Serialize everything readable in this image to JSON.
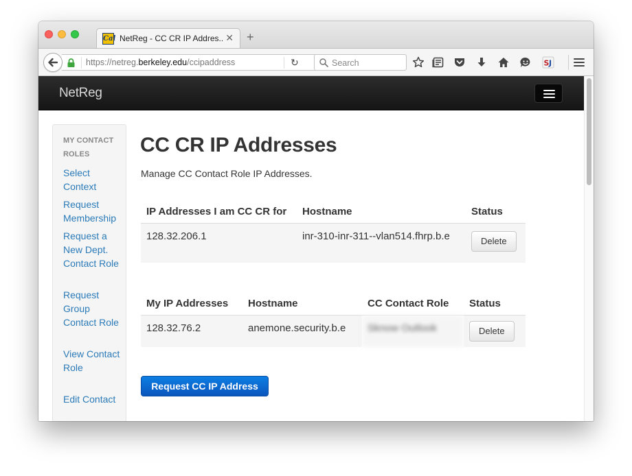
{
  "browser": {
    "tab": {
      "favicon_text": "Cal",
      "title": "NetReg - CC CR IP Addres..."
    },
    "address": {
      "prefix": "https://netreg.",
      "domain": "berkeley.edu",
      "path": "/ccipaddress"
    },
    "search_placeholder": "Search",
    "toolbar_icons": [
      "bookmark-star-icon",
      "reader-view-icon",
      "pocket-icon",
      "download-icon",
      "home-icon",
      "hello-chat-icon",
      "sj-extension-icon",
      "menu-icon"
    ]
  },
  "site": {
    "brand": "NetReg"
  },
  "sidebar": {
    "header": "MY CONTACT ROLES",
    "links": [
      "Select Context",
      "Request Membership",
      "Request a New Dept. Contact Role",
      "Request Group Contact Role",
      "View Contact Role",
      "Edit Contact"
    ]
  },
  "main": {
    "title": "CC CR IP Addresses",
    "description": "Manage CC Contact Role IP Addresses.",
    "table1": {
      "headers": [
        "IP Addresses I am CC CR for",
        "Hostname",
        "Status"
      ],
      "rows": [
        {
          "ip": "128.32.206.1",
          "hostname": "inr-310-inr-311--vlan514.fhrp.b.e",
          "action": "Delete"
        }
      ]
    },
    "table2": {
      "headers": [
        "My IP Addresses",
        "Hostname",
        "CC Contact Role",
        "Status"
      ],
      "rows": [
        {
          "ip": "128.32.76.2",
          "hostname": "anemone.security.b.e",
          "role": "Sknow Outlook",
          "action": "Delete"
        }
      ]
    },
    "request_button": "Request CC IP Address"
  },
  "colors": {
    "link": "#2a7ab8",
    "primary": "#0a6ad1",
    "navbar": "#1e1e1e"
  }
}
